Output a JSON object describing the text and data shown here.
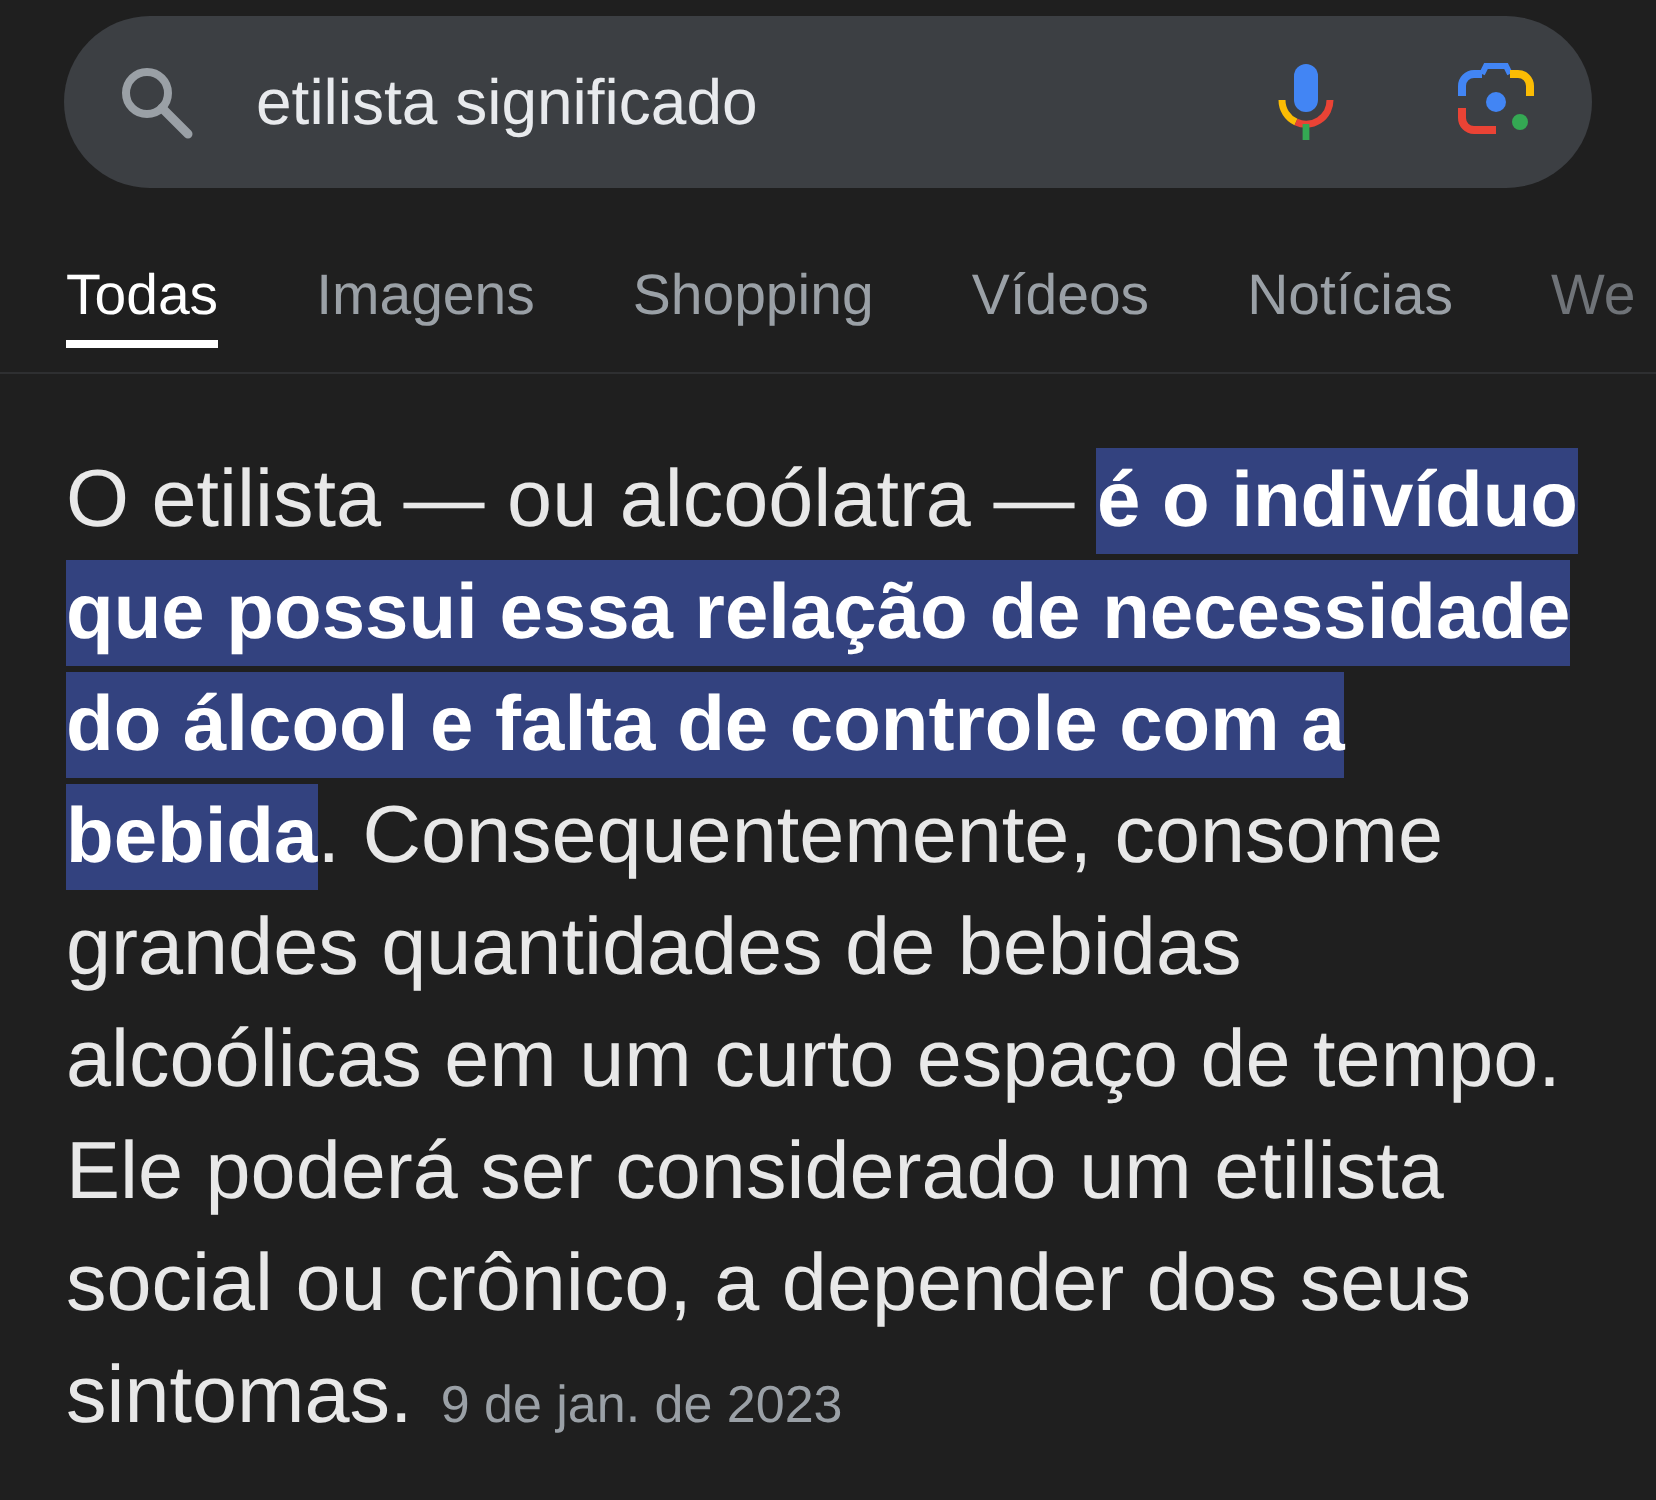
{
  "search": {
    "query": "etilista significado"
  },
  "tabs": [
    {
      "label": "Todas",
      "selected": true
    },
    {
      "label": "Imagens",
      "selected": false
    },
    {
      "label": "Shopping",
      "selected": false
    },
    {
      "label": "Vídeos",
      "selected": false
    },
    {
      "label": "Notícias",
      "selected": false
    },
    {
      "label": "We",
      "selected": false
    }
  ],
  "snippet": {
    "segments": [
      {
        "text": "O etilista — ou alcoólatra — ",
        "highlighted": false
      },
      {
        "text": "é o indivíduo que possui essa relação de necessidade do álcool e falta de controle com a bebida",
        "highlighted": true
      },
      {
        "text": ". Consequentemente, consome grandes quantidades de bebidas alcoólicas em um curto espaço de tempo. Ele poderá ser considerado um etilista social ou crônico, a depender dos seus sintomas.",
        "highlighted": false
      }
    ],
    "date": "9 de jan. de 2023"
  }
}
